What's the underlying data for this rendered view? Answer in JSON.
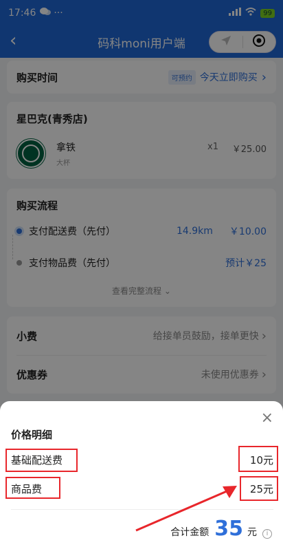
{
  "status": {
    "time": "17:46",
    "extra": "··· ",
    "battery": "99"
  },
  "nav": {
    "back": "‹",
    "title": "码科moni用户端"
  },
  "purchase_time": {
    "label": "购买时间",
    "tag": "可预约",
    "value": "今天立即购买",
    "arrow": "›"
  },
  "shop": {
    "name": "星巴克(青秀店)",
    "item": {
      "name": "拿铁",
      "spec": "大杯",
      "qty": "x1",
      "price": "￥25.00"
    }
  },
  "flow": {
    "title": "购买流程",
    "steps": [
      {
        "label": "支付配送费（先付）",
        "distance": "14.9km",
        "value": "￥10.00"
      },
      {
        "label": "支付物品费（先付）",
        "value": "预计￥25"
      }
    ],
    "more": "查看完整流程"
  },
  "tip": {
    "label": "小费",
    "hint": "给接单员鼓励，接单更快",
    "arrow": "›"
  },
  "coupon": {
    "label": "优惠券",
    "hint": "未使用优惠券",
    "arrow": "›"
  },
  "sheet": {
    "close": "×",
    "title": "价格明细",
    "rows": [
      {
        "label": "基础配送费",
        "value": "10元"
      },
      {
        "label": "商品费",
        "value": "25元"
      }
    ],
    "total_label": "合计金额",
    "total_amount": "35",
    "total_unit": "元",
    "info": "i"
  },
  "colors": {
    "brand": "#1f68d6",
    "accent": "#2f6fd9",
    "highlight": "#e8262b"
  }
}
